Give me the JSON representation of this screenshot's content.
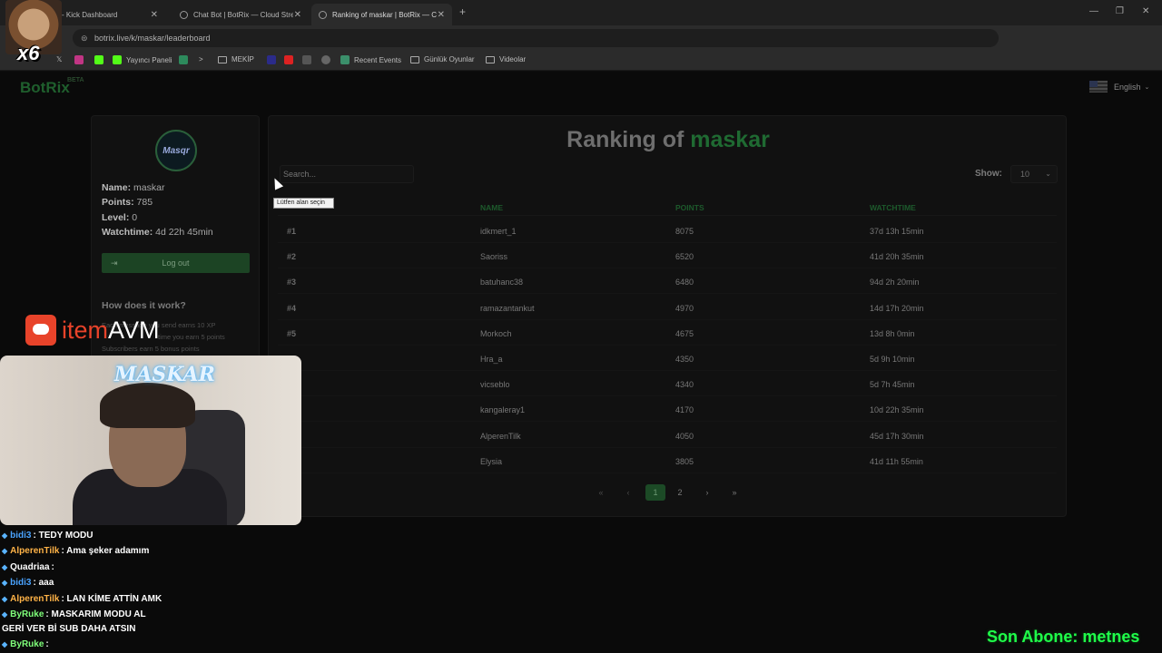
{
  "browser": {
    "tabs": [
      {
        "label": "- Kick Dashboard"
      },
      {
        "label": "Chat Bot | BotRix — Cloud Stre"
      },
      {
        "label": "Ranking of maskar | BotRix — C"
      }
    ],
    "url": "botrix.live/k/maskar/leaderboard",
    "bookmarks": [
      "Yayıncı Paneli",
      "MEKİP",
      "Recent Events",
      "Günlük Oyunlar",
      "Videolar"
    ]
  },
  "site": {
    "logo": "BotRix",
    "logo_badge": "BETA",
    "language": "English"
  },
  "profile": {
    "avatar_text": "Masqr",
    "name_label": "Name:",
    "name": "maskar",
    "points_label": "Points:",
    "points": "785",
    "level_label": "Level:",
    "level": "0",
    "watchtime_label": "Watchtime:",
    "watchtime": "4d 22h 45min",
    "logout": "Log out",
    "how_title": "How does it work?",
    "how_lines": [
      "Each message you send earns 10 XP",
      "time you earn 5 points",
      "Subscribers earn 5 bonus points"
    ]
  },
  "ranking": {
    "title_prefix": "Ranking of",
    "title_name": "maskar",
    "search_placeholder": "Search...",
    "show_label": "Show:",
    "show_value": "10",
    "columns": [
      "NAME",
      "POINTS",
      "WATCHTIME"
    ],
    "rows": [
      {
        "rank": "#1",
        "name": "idkmert_1",
        "points": "8075",
        "watchtime": "37d 13h 15min"
      },
      {
        "rank": "#2",
        "name": "Saoriss",
        "points": "6520",
        "watchtime": "41d 20h 35min"
      },
      {
        "rank": "#3",
        "name": "batuhanc38",
        "points": "6480",
        "watchtime": "94d 2h 20min"
      },
      {
        "rank": "#4",
        "name": "ramazantankut",
        "points": "4970",
        "watchtime": "14d 17h 20min"
      },
      {
        "rank": "#5",
        "name": "Morkoch",
        "points": "4675",
        "watchtime": "13d 8h 0min"
      },
      {
        "rank": "",
        "name": "Hra_a",
        "points": "4350",
        "watchtime": "5d 9h 10min"
      },
      {
        "rank": "",
        "name": "vicseblo",
        "points": "4340",
        "watchtime": "5d 7h 45min"
      },
      {
        "rank": "",
        "name": "kangaleray1",
        "points": "4170",
        "watchtime": "10d 22h 35min"
      },
      {
        "rank": "",
        "name": "AlperenTilk",
        "points": "4050",
        "watchtime": "45d 17h 30min"
      },
      {
        "rank": "",
        "name": "Elysia",
        "points": "3805",
        "watchtime": "41d 11h 55min"
      }
    ],
    "pagination": {
      "first": "«",
      "prev": "‹",
      "pages": [
        "1",
        "2"
      ],
      "current": "1",
      "next": "›",
      "last": "»"
    },
    "tooltip": "Lütfen alan seçin"
  },
  "overlay": {
    "multiplier": "x6",
    "sponsor_a": "item",
    "sponsor_b": "AVM",
    "webcam_logo": "MASKAR",
    "chat": [
      {
        "user": "bidi3",
        "color": "#4aa3ff",
        "text": ": TEDY MODU"
      },
      {
        "user": "AlperenTilk",
        "color": "#ffb347",
        "text": ": Ama şeker adamım"
      },
      {
        "user": "Quadriaa",
        "color": "#ffffff",
        "text": ":"
      },
      {
        "user": "bidi3",
        "color": "#4aa3ff",
        "text": ": aaa"
      },
      {
        "user": "AlperenTilk",
        "color": "#ffb347",
        "text": ": LAN KİME ATTİN AMK"
      },
      {
        "user": "ByRuke",
        "color": "#7fff7a",
        "text": ": MASKARIM MODU AL"
      },
      {
        "user": "",
        "color": "#ffffff",
        "text": "GERİ VER Bİ SUB DAHA ATSIN"
      },
      {
        "user": "ByRuke",
        "color": "#7fff7a",
        "text": ":"
      }
    ],
    "last_sub": "Son Abone: metnes"
  }
}
